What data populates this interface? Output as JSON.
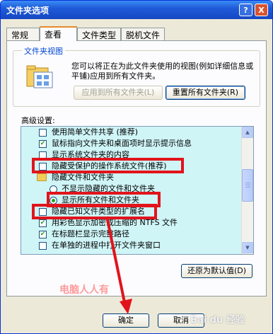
{
  "window": {
    "title": "文件夹选项",
    "help": "?",
    "close": "X"
  },
  "tabs": [
    {
      "label": "常规"
    },
    {
      "label": "查看"
    },
    {
      "label": "文件类型"
    },
    {
      "label": "脱机文件"
    }
  ],
  "folder_views": {
    "group_title": "文件夹视图",
    "description": "您可以将正在为此文件夹使用的视图(例如详细信息或平铺)应用到所有文件夹。",
    "apply_button": "应用到所有文件夹(L)",
    "reset_button": "重置所有文件夹(R)"
  },
  "advanced": {
    "label": "高级设置:",
    "items": [
      {
        "text": "使用简单文件共享 (推荐)",
        "type": "checkbox",
        "checked": false
      },
      {
        "text": "鼠标指向文件夹和桌面项时显示提示信息",
        "type": "checkbox",
        "checked": true
      },
      {
        "text": "显示系统文件夹的内容",
        "type": "checkbox",
        "checked": false
      },
      {
        "text": "隐藏受保护的操作系统文件(推荐)",
        "type": "checkbox",
        "checked": false
      },
      {
        "text": "隐藏文件和文件夹",
        "type": "folder"
      },
      {
        "text": "不显示隐藏的文件和文件夹",
        "type": "radio",
        "checked": false
      },
      {
        "text": "显示所有文件和文件夹",
        "type": "radio",
        "checked": true
      },
      {
        "text": "隐藏已知文件类型的扩展名",
        "type": "checkbox",
        "checked": false
      },
      {
        "text": "用彩色显示加密或压缩的 NTFS 文件",
        "type": "checkbox",
        "checked": true
      },
      {
        "text": "在标题栏显示完整路径",
        "type": "checkbox",
        "checked": true
      },
      {
        "text": "在单独的进程中打开文件夹窗口",
        "type": "checkbox",
        "checked": false
      }
    ],
    "restore_button": "还原为默认值(D)"
  },
  "buttons": {
    "ok": "确定",
    "cancel": "取消"
  },
  "watermark": "电脑人人有",
  "baidu": "Bai du 经验",
  "colors": {
    "highlight": "#e1141c",
    "list_bg": "#cff5f7",
    "title_blue": "#1f5bd8"
  }
}
